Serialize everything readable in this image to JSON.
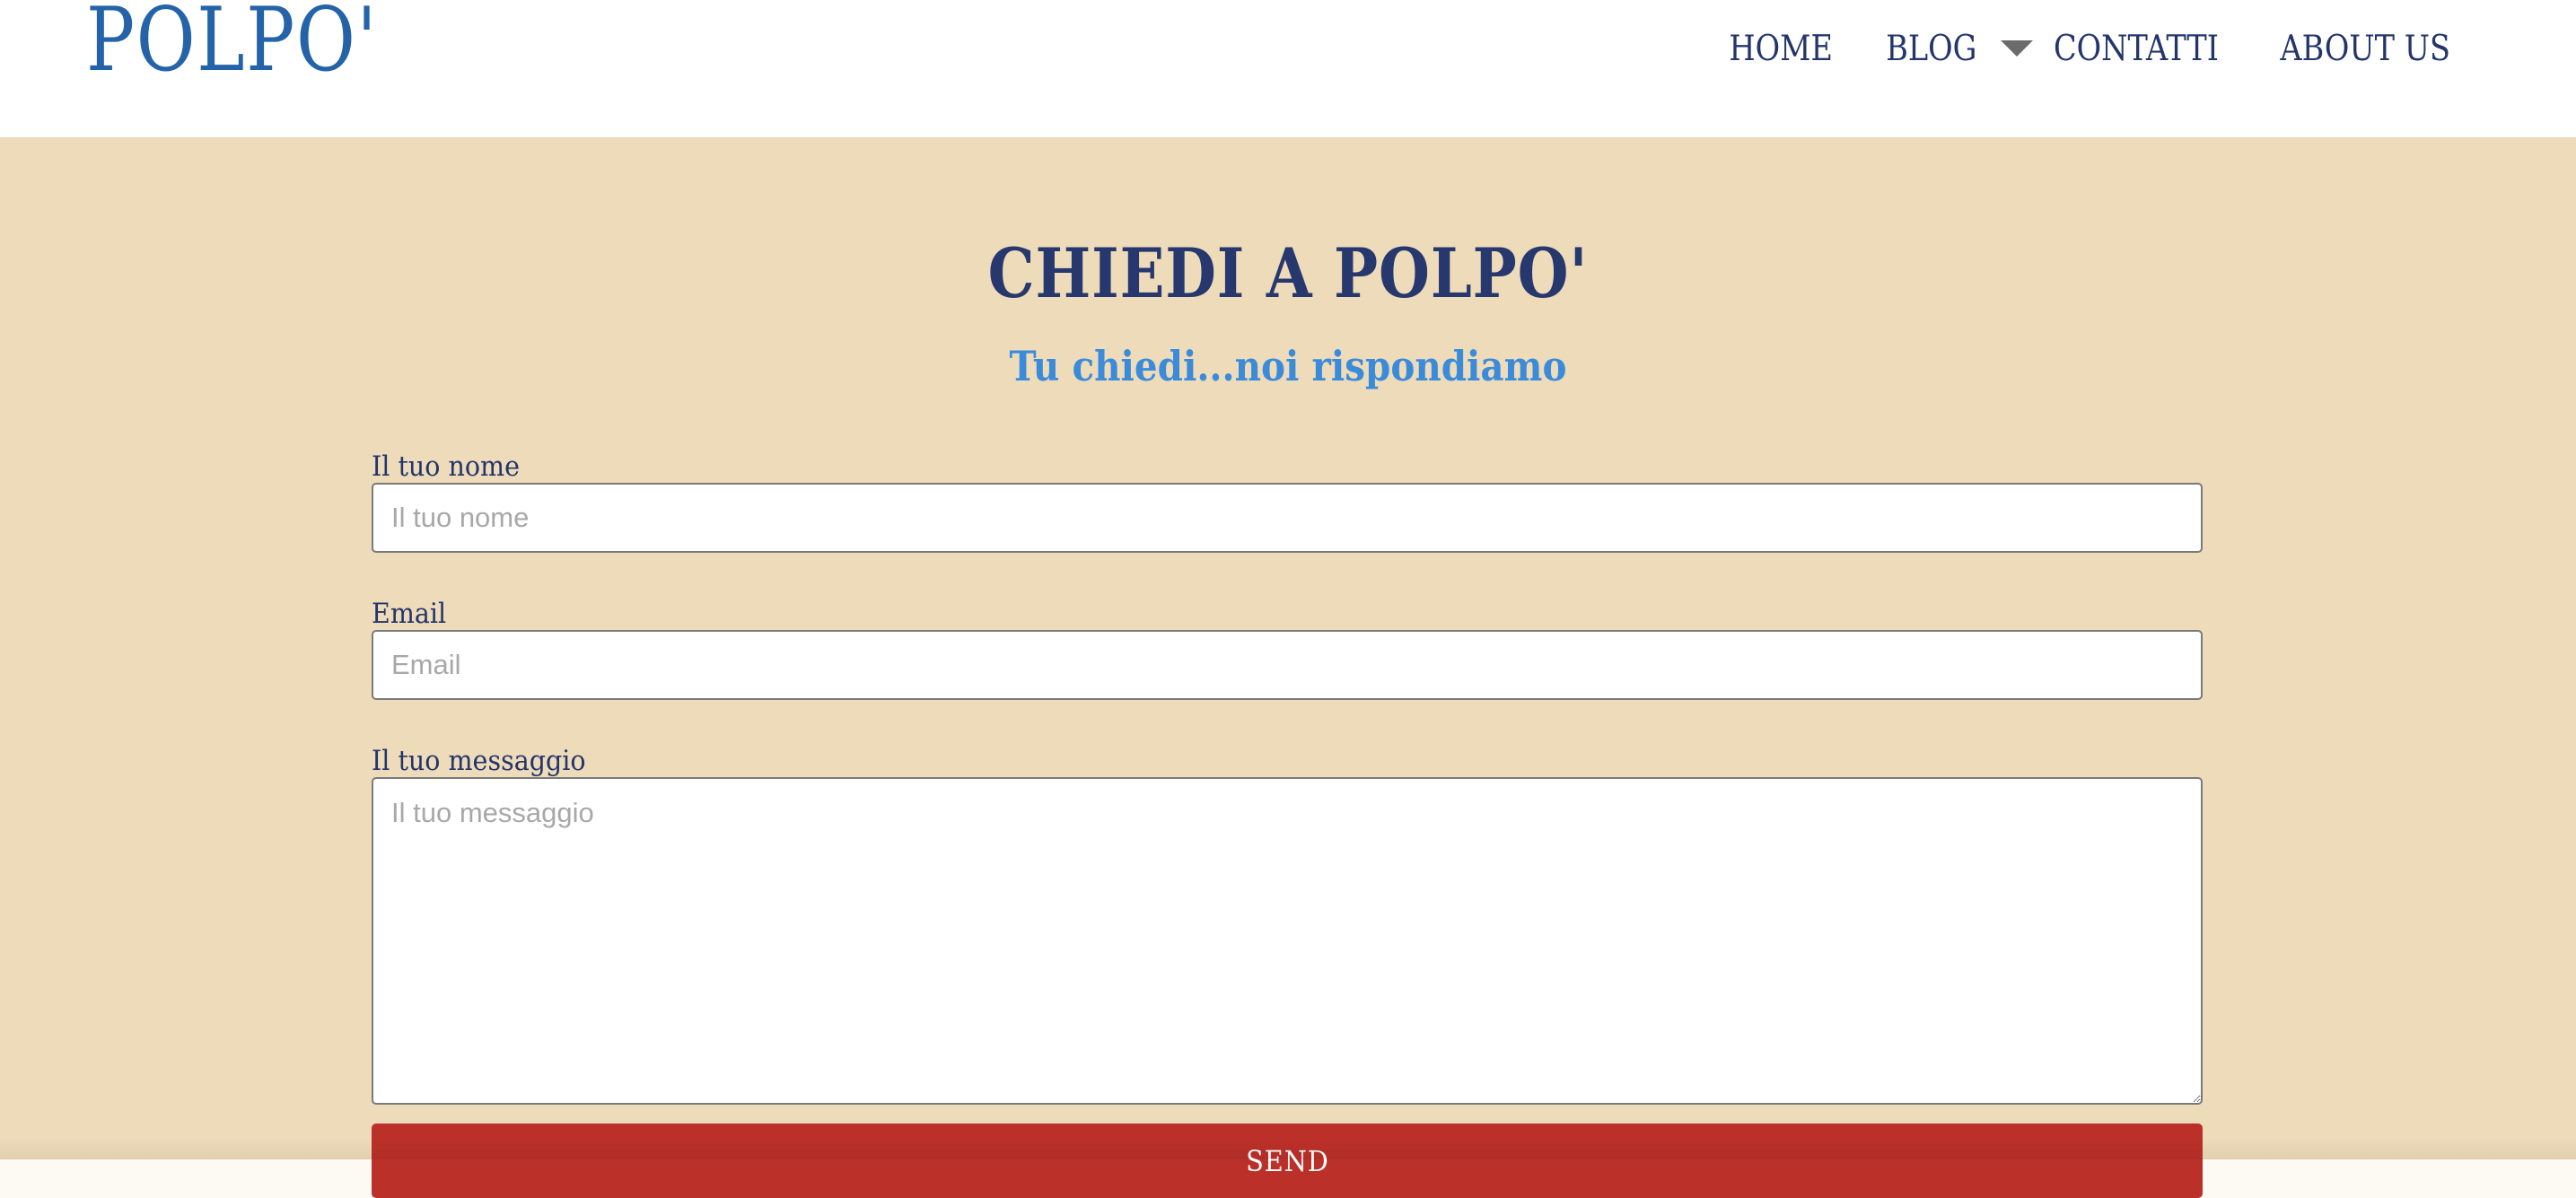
{
  "header": {
    "logo": "POLPO'",
    "nav": {
      "home": "HOME",
      "blog": "BLOG",
      "blog_caret_icon": "caret-down-icon",
      "contatti": "CONTATTI",
      "about": "ABOUT US"
    }
  },
  "main": {
    "title": "CHIEDI A POLPO'",
    "subtitle": "Tu chiedi...noi rispondiamo",
    "form": {
      "name_label": "Il tuo nome",
      "name_placeholder": "Il tuo nome",
      "name_value": "",
      "email_label": "Email",
      "email_placeholder": "Email",
      "email_value": "",
      "message_label": "Il tuo messaggio",
      "message_placeholder": "Il tuo messaggio",
      "message_value": "",
      "send_label": "SEND"
    }
  },
  "colors": {
    "brand_blue": "#2563a8",
    "nav_navy": "#23356b",
    "accent_blue": "#3b8bdb",
    "background_beige": "#eedbba",
    "send_red": "#bb3029"
  }
}
